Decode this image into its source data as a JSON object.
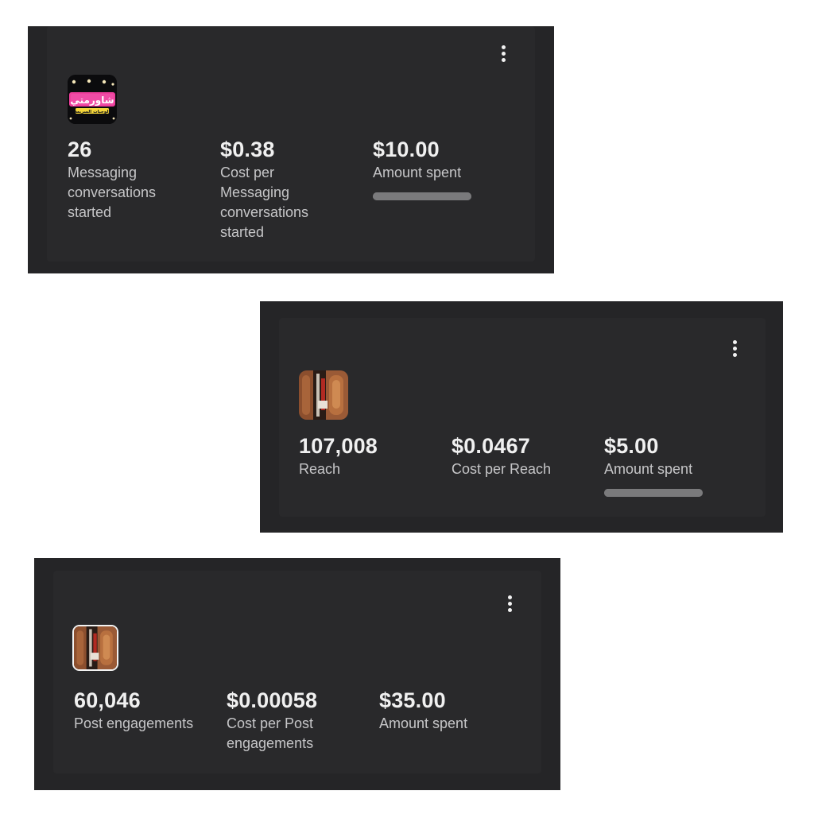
{
  "cards": [
    {
      "thumbnail": {
        "icon": "restaurant-logo-thumbnail",
        "logo_text": "شاورمتي",
        "logo_subtext": "الوجبات السريعة"
      },
      "metrics": [
        {
          "value": "26",
          "label": "Messaging conversations started"
        },
        {
          "value": "$0.38",
          "label": "Cost per Messaging conversations started"
        },
        {
          "value": "$10.00",
          "label": "Amount spent"
        }
      ],
      "spend_progress": 1.0
    },
    {
      "thumbnail": {
        "icon": "shawarma-photo-thumbnail"
      },
      "metrics": [
        {
          "value": "107,008",
          "label": "Reach"
        },
        {
          "value": "$0.0467",
          "label": "Cost per Reach"
        },
        {
          "value": "$5.00",
          "label": "Amount spent"
        }
      ],
      "spend_progress": 1.0
    },
    {
      "thumbnail": {
        "icon": "shawarma-photo-thumbnail"
      },
      "metrics": [
        {
          "value": "60,046",
          "label": "Post engagements"
        },
        {
          "value": "$0.00058",
          "label": "Cost per Post engagements"
        },
        {
          "value": "$35.00",
          "label": "Amount spent"
        }
      ]
    }
  ],
  "icons": {
    "menu": "more-vertical-icon"
  },
  "colors": {
    "frame_bg": "#252527",
    "card_bg": "#29292b",
    "value_text": "#f0f0f0",
    "label_text": "#c6c6c8",
    "progress_bar": "#7a7a7c"
  }
}
